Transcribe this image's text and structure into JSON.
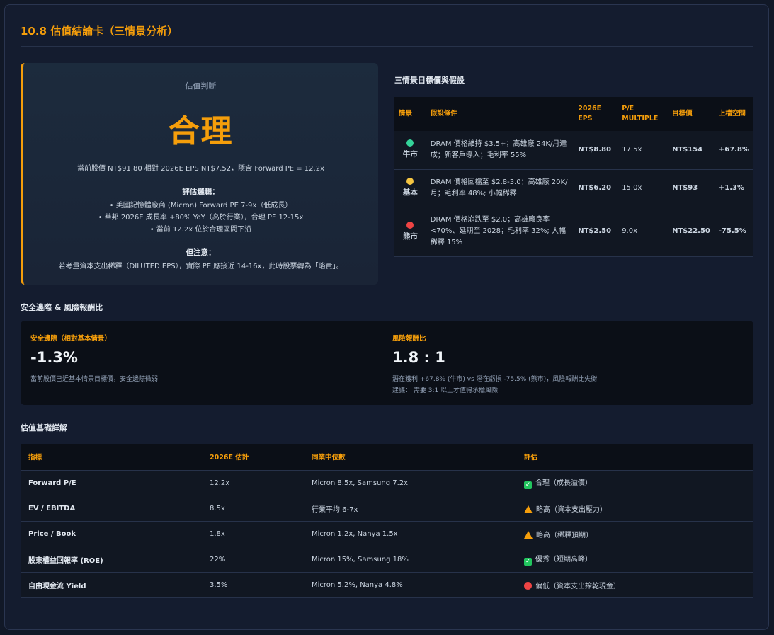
{
  "card": {
    "title": "10.8 估值結論卡（三情景分析）"
  },
  "verdict": {
    "label": "估值判斷",
    "main": "合理",
    "price_line": "當前股價 NT$91.80 相對 2026E EPS NT$7.52，隱含 Forward PE = 12.2x",
    "logic_title": "評估邏輯：",
    "bullets": [
      "• 美國記憶體廠商 (Micron) Forward PE 7-9x（低成長）",
      "• 華邦 2026E 成長率 +80% YoY（高於行業），合理 PE 12-15x",
      "• 當前 12.2x 位於合理區間下沿"
    ],
    "note_title": "但注意：",
    "note": "若考量資本支出稀釋（DILUTED EPS），實際 PE 應接近 14-16x，此時股票轉為「略貴」。",
    "accent": "#f59e0b"
  },
  "scenarios": {
    "title": "三情景目標價與假設",
    "headers": [
      "情景",
      "假設條件",
      "2026E EPS",
      "P/E MULTIPLE",
      "目標價",
      "上檔空間"
    ],
    "rows": [
      {
        "name": "牛市",
        "assumption": "DRAM 價格維持 $3.5+；高雄廠 24K/月達成；新客戶導入；毛利率 55%",
        "eps": "NT$8.80",
        "pe": "17.5x",
        "target": "NT$154",
        "upside": "+67.8%",
        "color": "#34d399"
      },
      {
        "name": "基本",
        "assumption": "DRAM 價格回檔至 $2.8-3.0；高雄廠 20K/月；毛利率 48%; 小幅稀釋",
        "eps": "NT$6.20",
        "pe": "15.0x",
        "target": "NT$93",
        "upside": "+1.3%",
        "color": "#f59e0b"
      },
      {
        "name": "熊市",
        "assumption": "DRAM 價格崩跌至 $2.0；高雄廠良率 <70%、延期至 2028；毛利率 32%; 大幅稀釋 15%",
        "eps": "NT$2.50",
        "pe": "9.0x",
        "target": "NT$22.50",
        "upside": "-75.5%",
        "color": "#ef4444"
      }
    ]
  },
  "safety": {
    "title": "安全邊際 & 風險報酬比",
    "margin_label": "安全邊際（相對基本情景）",
    "margin_value": "-1.3%",
    "margin_desc": "當前股價已近基本情景目標價，安全邊際微弱",
    "ratio_label": "風險報酬比",
    "ratio_value": "1.8 : 1",
    "ratio_desc1": "潛在獲利 +67.8% (牛市) vs 潛在虧損 -75.5% (熊市)，風險報酬比失衡",
    "ratio_desc2": "建議： 需要 3:1 以上才值得承擔風險"
  },
  "basis": {
    "title": "估值基礎詳解",
    "headers": [
      "指標",
      "2026E 估計",
      "同業中位數",
      "評估"
    ],
    "rows": [
      {
        "metric": "Forward P/E",
        "estimate": "12.2x",
        "peer": "Micron 8.5x, Samsung 7.2x",
        "icon": "check-icon",
        "assess": "合理（成長溢價）"
      },
      {
        "metric": "EV / EBITDA",
        "estimate": "8.5x",
        "peer": "行業平均 6-7x",
        "icon": "warning-icon",
        "assess": "略高（資本支出壓力）"
      },
      {
        "metric": "Price / Book",
        "estimate": "1.8x",
        "peer": "Micron 1.2x, Nanya 1.5x",
        "icon": "warning-icon",
        "assess": "略高（稀釋預期）"
      },
      {
        "metric": "股東權益回報率 (ROE)",
        "estimate": "22%",
        "peer": "Micron 15%, Samsung 18%",
        "icon": "check-icon",
        "assess": "優秀（短期高峰）"
      },
      {
        "metric": "自由現金流 Yield",
        "estimate": "3.5%",
        "peer": "Micron 5.2%, Nanya 4.8%",
        "icon": "red-circle-icon",
        "assess": "偏低（資本支出搾乾現金）"
      }
    ]
  }
}
